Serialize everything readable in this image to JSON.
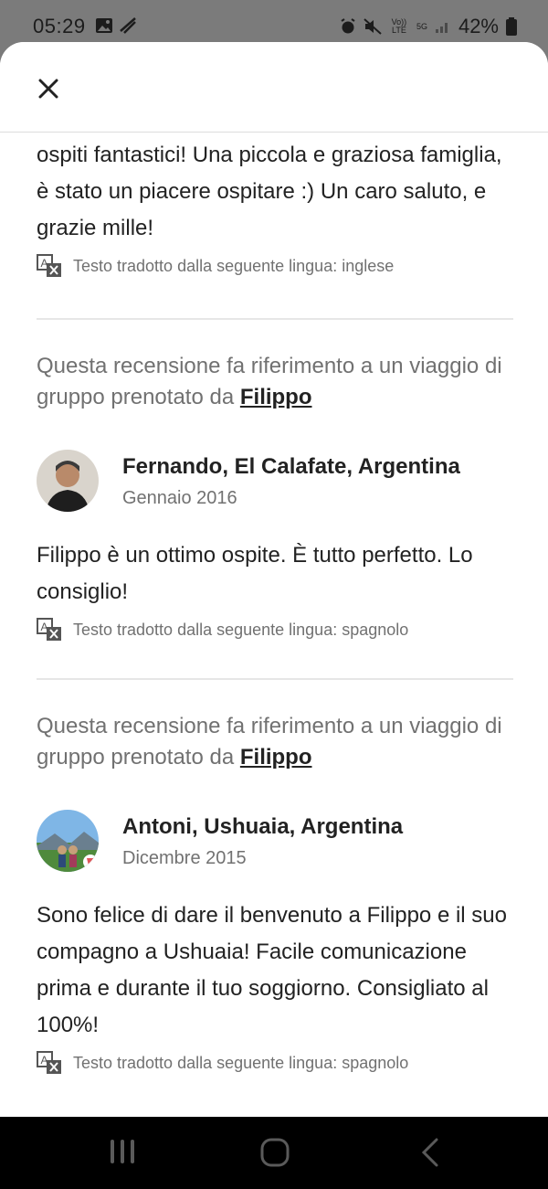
{
  "status_bar": {
    "time": "05:29",
    "battery": "42%",
    "network": "5G",
    "volte": "Vo)) LTE"
  },
  "reviews_partial": {
    "text": "ospiti fantastici! Una piccola e graziosa famiglia, è stato un piacere ospitare :) Un caro saluto, e grazie mille!",
    "translated_note": "Testo tradotto dalla seguente lingua: inglese"
  },
  "reviews": [
    {
      "group_note_prefix": "Questa recensione fa riferimento a un viaggio di gruppo prenotato da",
      "host_name": "Filippo",
      "reviewer_name": "Fernando, El Calafate, Argentina",
      "date": "Gennaio 2016",
      "text": "Filippo è un ottimo ospite. È tutto perfetto. Lo consiglio!",
      "translated_note": "Testo tradotto dalla seguente lingua: spagnolo"
    },
    {
      "group_note_prefix": "Questa recensione fa riferimento a un viaggio di gruppo prenotato da",
      "host_name": "Filippo",
      "reviewer_name": "Antoni, Ushuaia, Argentina",
      "date": "Dicembre 2015",
      "text": "Sono felice di dare il benvenuto a Filippo e il suo compagno a Ushuaia! Facile comunicazione prima e durante il tuo soggiorno. Consigliato al 100%!",
      "translated_note": "Testo tradotto dalla seguente lingua: spagnolo"
    }
  ],
  "icons": {
    "close": "close-icon",
    "translate": "translate-icon"
  },
  "colors": {
    "text_primary": "#222222",
    "text_secondary": "#717171",
    "divider": "#e6e6e6",
    "backdrop": "#7b7b7b"
  }
}
